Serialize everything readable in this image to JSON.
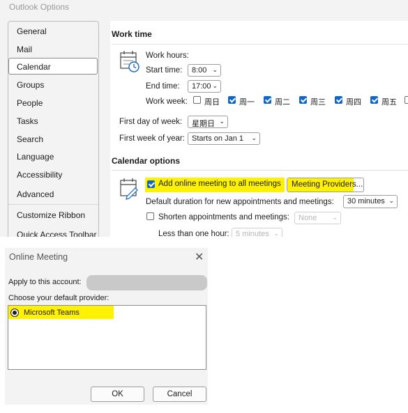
{
  "window": {
    "title": "Outlook Options"
  },
  "sidebar": {
    "items": [
      {
        "label": "General"
      },
      {
        "label": "Mail"
      },
      {
        "label": "Calendar"
      },
      {
        "label": "Groups"
      },
      {
        "label": "People"
      },
      {
        "label": "Tasks"
      },
      {
        "label": "Search"
      },
      {
        "label": "Language"
      },
      {
        "label": "Accessibility"
      },
      {
        "label": "Advanced"
      },
      {
        "label": "Customize Ribbon"
      },
      {
        "label": "Quick Access Toolbar"
      }
    ],
    "selected": "Calendar"
  },
  "work_time": {
    "title": "Work time",
    "work_hours_label": "Work hours:",
    "start_label": "Start time:",
    "start_value": "8:00",
    "end_label": "End time:",
    "end_value": "17:00",
    "work_week_label": "Work week:",
    "days": [
      {
        "label": "周日",
        "checked": false
      },
      {
        "label": "周一",
        "checked": true
      },
      {
        "label": "周二",
        "checked": true
      },
      {
        "label": "周三",
        "checked": true
      },
      {
        "label": "周四",
        "checked": true
      },
      {
        "label": "周五",
        "checked": true
      }
    ],
    "first_day_label": "First day of week:",
    "first_day_value": "星期日",
    "first_week_label": "First week of year:",
    "first_week_value": "Starts on Jan 1"
  },
  "calendar_options": {
    "title": "Calendar options",
    "add_online_label": "Add online meeting to all meetings",
    "add_online_checked": true,
    "meeting_providers_label": "Meeting Providers...",
    "default_duration_label": "Default duration for new appointments and meetings:",
    "default_duration_value": "30 minutes",
    "shorten_label": "Shorten appointments and meetings:",
    "shorten_checked": false,
    "shorten_value": "None",
    "less_than_hour_label": "Less than one hour:",
    "less_than_hour_value": "5 minutes"
  },
  "dialog": {
    "title": "Online Meeting",
    "apply_label": "Apply to this account:",
    "choose_label": "Choose your default provider:",
    "providers": [
      {
        "label": "Microsoft Teams",
        "selected": true
      }
    ],
    "ok_label": "OK",
    "cancel_label": "Cancel"
  },
  "colors": {
    "highlight": "#fff200",
    "checkbox_blue": "#1167c7",
    "window_bg": "#f3f3f3"
  }
}
